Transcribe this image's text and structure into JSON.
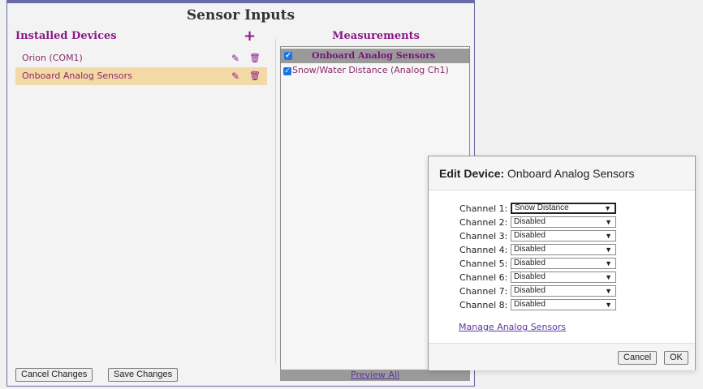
{
  "title": "Sensor Inputs",
  "installed": {
    "title": "Installed Devices",
    "add_icon": "plus-icon",
    "devices": [
      {
        "label": "Orion (COM1)",
        "selected": false
      },
      {
        "label": "Onboard Analog Sensors",
        "selected": true
      }
    ]
  },
  "measurements": {
    "title": "Measurements",
    "group_label": "Onboard Analog Sensors",
    "group_checked": true,
    "items": [
      {
        "label": "Snow/Water Distance (Analog Ch1)",
        "checked": true
      }
    ],
    "preview_label": "Preview All"
  },
  "footer": {
    "cancel_label": "Cancel Changes",
    "save_label": "Save Changes"
  },
  "dialog": {
    "title_prefix": "Edit Device:",
    "title_name": "Onboard Analog Sensors",
    "channels": [
      {
        "label": "Channel 1:",
        "value": "Snow Distance"
      },
      {
        "label": "Channel 2:",
        "value": "Disabled"
      },
      {
        "label": "Channel 3:",
        "value": "Disabled"
      },
      {
        "label": "Channel 4:",
        "value": "Disabled"
      },
      {
        "label": "Channel 5:",
        "value": "Disabled"
      },
      {
        "label": "Channel 6:",
        "value": "Disabled"
      },
      {
        "label": "Channel 7:",
        "value": "Disabled"
      },
      {
        "label": "Channel 8:",
        "value": "Disabled"
      }
    ],
    "manage_link": "Manage Analog Sensors",
    "cancel_label": "Cancel",
    "ok_label": "OK"
  },
  "colors": {
    "accent_purple": "#8b1a8b",
    "selected_row": "#f3d9a5",
    "checkbox": "#1a73e8"
  }
}
